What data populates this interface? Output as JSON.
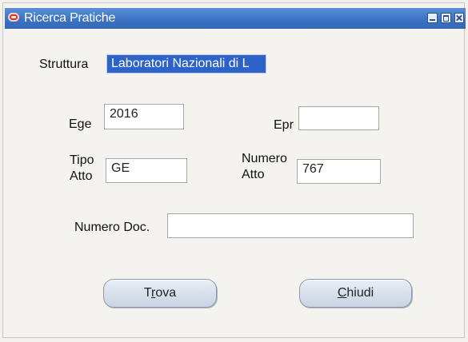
{
  "window": {
    "title": "Ricerca Pratiche"
  },
  "form": {
    "struttura_label": "Struttura",
    "struttura_value": "Laboratori Nazionali di L",
    "ege_label": "Ege",
    "ege_value": "2016",
    "epr_label": "Epr",
    "epr_value": "",
    "tipo_atto_label_line1": "Tipo",
    "tipo_atto_label_line2": "Atto",
    "tipo_atto_value": "GE",
    "numero_atto_label_line1": "Numero",
    "numero_atto_label_line2": "Atto",
    "numero_atto_value": "767",
    "numero_doc_label": "Numero Doc.",
    "numero_doc_value": ""
  },
  "buttons": {
    "find_before": "T",
    "find_mnemonic": "r",
    "find_after": "ova",
    "close_before": "",
    "close_mnemonic": "C",
    "close_after": "hiudi"
  },
  "colors": {
    "titlebar": "#3e73c4",
    "selection": "#2d63c8",
    "window_background": "#f4f3ef"
  },
  "icons": {
    "app": "oracle-forms-icon",
    "minimize": "minimize-icon",
    "maximize": "maximize-icon",
    "close": "close-icon"
  }
}
